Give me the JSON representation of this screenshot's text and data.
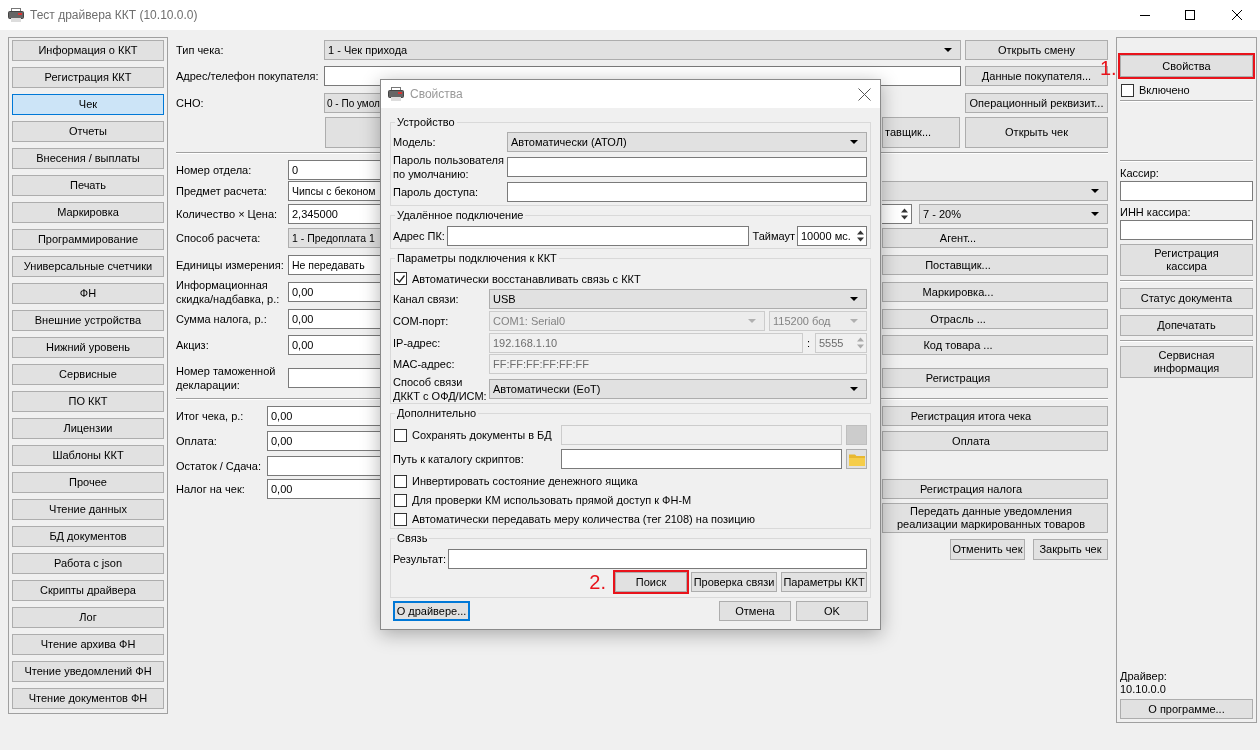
{
  "window": {
    "title": "Тест драйвера ККТ (10.10.0.0)"
  },
  "sidebar": {
    "items": [
      {
        "label": "Информация о ККТ",
        "selected": false
      },
      {
        "label": "Регистрация ККТ",
        "selected": false
      },
      {
        "label": "Чек",
        "selected": true
      },
      {
        "label": "Отчеты",
        "selected": false
      },
      {
        "label": "Внесения / выплаты",
        "selected": false
      },
      {
        "label": "Печать",
        "selected": false
      },
      {
        "label": "Маркировка",
        "selected": false
      },
      {
        "label": "Программирование",
        "selected": false
      },
      {
        "label": "Универсальные счетчики",
        "selected": false
      },
      {
        "label": "ФН",
        "selected": false
      },
      {
        "label": "Внешние устройства",
        "selected": false
      },
      {
        "label": "Нижний уровень",
        "selected": false
      },
      {
        "label": "Сервисные",
        "selected": false
      },
      {
        "label": "ПО ККТ",
        "selected": false
      },
      {
        "label": "Лицензии",
        "selected": false
      },
      {
        "label": "Шаблоны ККТ",
        "selected": false
      },
      {
        "label": "Прочее",
        "selected": false
      },
      {
        "label": "Чтение данных",
        "selected": false
      },
      {
        "label": "БД документов",
        "selected": false
      },
      {
        "label": "Работа с json",
        "selected": false
      },
      {
        "label": "Скрипты драйвера",
        "selected": false
      },
      {
        "label": "Лог",
        "selected": false
      },
      {
        "label": "Чтение архива ФН",
        "selected": false
      },
      {
        "label": "Чтение уведомлений ФН",
        "selected": false
      },
      {
        "label": "Чтение документов ФН",
        "selected": false
      }
    ]
  },
  "receipt": {
    "header_fields": [
      {
        "kind": "combo",
        "label": "Тип чека:",
        "value": "1 - Чек прихода",
        "button": "Открыть смену"
      },
      {
        "kind": "input",
        "label": "Адрес/телефон покупателя:",
        "button": "Данные покупателя..."
      },
      {
        "kind": "combo",
        "label": "СНО:",
        "value": "0 - По умол",
        "button": "Операционный реквизит..."
      }
    ],
    "header_actions": {
      "partial_button": "тавщик...",
      "button": "Открыть чек"
    },
    "position_fields": [
      {
        "kind": "input",
        "label": "Номер отдела:",
        "value": "0"
      },
      {
        "kind": "edit-combo",
        "label": "Предмет расчета:",
        "value": "Чипсы с беконом"
      },
      {
        "kind": "quantity",
        "label": "Количество × Цена:",
        "value": "2,345000",
        "vat": "7 - 20%"
      },
      {
        "kind": "combo",
        "label": "Способ расчета:",
        "value": "1 - Предоплата 1",
        "button": "Агент..."
      },
      {
        "kind": "edit-combo",
        "label": "Единицы измерения:",
        "value": "Не передавать",
        "button": "Поставщик..."
      },
      {
        "kind": "input",
        "label": "Информационная скидка/надбавка, р.:",
        "value": "0,00",
        "button": "Маркировка..."
      },
      {
        "kind": "input",
        "label": "Сумма налога, р.:",
        "value": "0,00",
        "button": "Отрасль ..."
      },
      {
        "kind": "input",
        "label": "Акциз:",
        "value": "0,00",
        "button": "Код товара ..."
      },
      {
        "kind": "input",
        "label": "Номер таможенной декларации:",
        "button": "Регистрация"
      }
    ],
    "total_fields": [
      {
        "label": "Итог чека, р.:",
        "value": "0,00",
        "button": "Регистрация итога чека"
      },
      {
        "label": "Оплата:",
        "value": "0,00",
        "button": "Оплата"
      },
      {
        "label": "Остаток / Сдача:"
      },
      {
        "label": "Налог на чек:",
        "value": "0,00",
        "button": "Регистрация налога"
      }
    ],
    "notice_button": "Передать данные уведомления реализации маркированных товаров",
    "receipt_buttons": [
      "Отменить чек",
      "Закрыть чек"
    ]
  },
  "device_panel": {
    "properties_button": {
      "label": "Свойства",
      "callout": "1."
    },
    "enabled": {
      "label": "Включено",
      "checked": false
    },
    "cashier": {
      "label": "Кассир:"
    },
    "cashier_inn": {
      "label": "ИНН кассира:"
    },
    "cashier_button": "Регистрация кассира",
    "document_buttons": [
      "Статус документа",
      "Допечатать"
    ],
    "service_button": "Сервисная информация",
    "driver_label": "Драйвер:",
    "driver_version": "10.10.0.0",
    "about_button": "О программе..."
  },
  "properties_dialog": {
    "title": "Свойства",
    "device_group": {
      "title": "Устройство",
      "model": {
        "label": "Модель:",
        "value": "Автоматически (АТОЛ)"
      },
      "user_password": {
        "label": "Пароль пользователя по умолчанию:"
      },
      "access_password": {
        "label": "Пароль доступа:"
      }
    },
    "remote_group": {
      "title": "Удалённое подключение",
      "address": {
        "label": "Адрес ПК:"
      },
      "timeout": {
        "label": "Таймаут",
        "value": "10000 мс."
      }
    },
    "connection_group": {
      "title": "Параметры подключения к ККТ",
      "auto_reconnect": {
        "label": "Автоматически восстанавливать связь с ККТ",
        "checked": true
      },
      "rows": [
        {
          "label": "Канал связи:",
          "fields": [
            {
              "kind": "combo",
              "value": "USB",
              "disabled": false
            }
          ]
        },
        {
          "label": "COM-порт:",
          "fields": [
            {
              "kind": "combo",
              "value": "COM1: Serial0",
              "disabled": true
            },
            {
              "kind": "combo",
              "value": "115200 бод",
              "disabled": true
            }
          ]
        },
        {
          "label": "IP-адрес:",
          "fields": [
            {
              "kind": "input",
              "value": "192.168.1.10",
              "disabled": true
            },
            {
              "kind": "text",
              "value": ":",
              "disabled": false
            },
            {
              "kind": "spin",
              "value": "5555",
              "disabled": true
            }
          ]
        },
        {
          "label": "MAC-адрес:",
          "fields": [
            {
              "kind": "input",
              "value": "FF:FF:FF:FF:FF:FF",
              "disabled": true
            }
          ]
        },
        {
          "label": "Способ связи ДККТ с ОФД/ИСМ:",
          "fields": [
            {
              "kind": "combo",
              "value": "Автоматически (EoT)",
              "disabled": false
            }
          ]
        }
      ]
    },
    "extra_group": {
      "title": "Дополнительно",
      "save_to_db": {
        "label": "Сохранять документы в БД",
        "checked": false
      },
      "db_path": {
        "disabled": true
      },
      "scripts_path": {
        "label": "Путь к каталогу скриптов:"
      },
      "options": [
        {
          "label": "Инвертировать состояние денежного ящика",
          "checked": false
        },
        {
          "label": "Для проверки КМ использовать прямой доступ к ФН-М",
          "checked": false
        },
        {
          "label": "Автоматически передавать меру количества (тег 2108) на позицию",
          "checked": false
        }
      ]
    },
    "link_group": {
      "title": "Связь",
      "result": {
        "label": "Результат:"
      },
      "buttons": [
        {
          "label": "Поиск",
          "callout": "2."
        },
        {
          "label": "Проверка связи"
        },
        {
          "label": "Параметры ККТ"
        }
      ]
    },
    "footer_buttons": [
      {
        "label": "О драйвере...",
        "focused": true
      },
      {
        "label": "Отмена",
        "focused": false
      },
      {
        "label": "OK",
        "focused": false
      }
    ]
  }
}
